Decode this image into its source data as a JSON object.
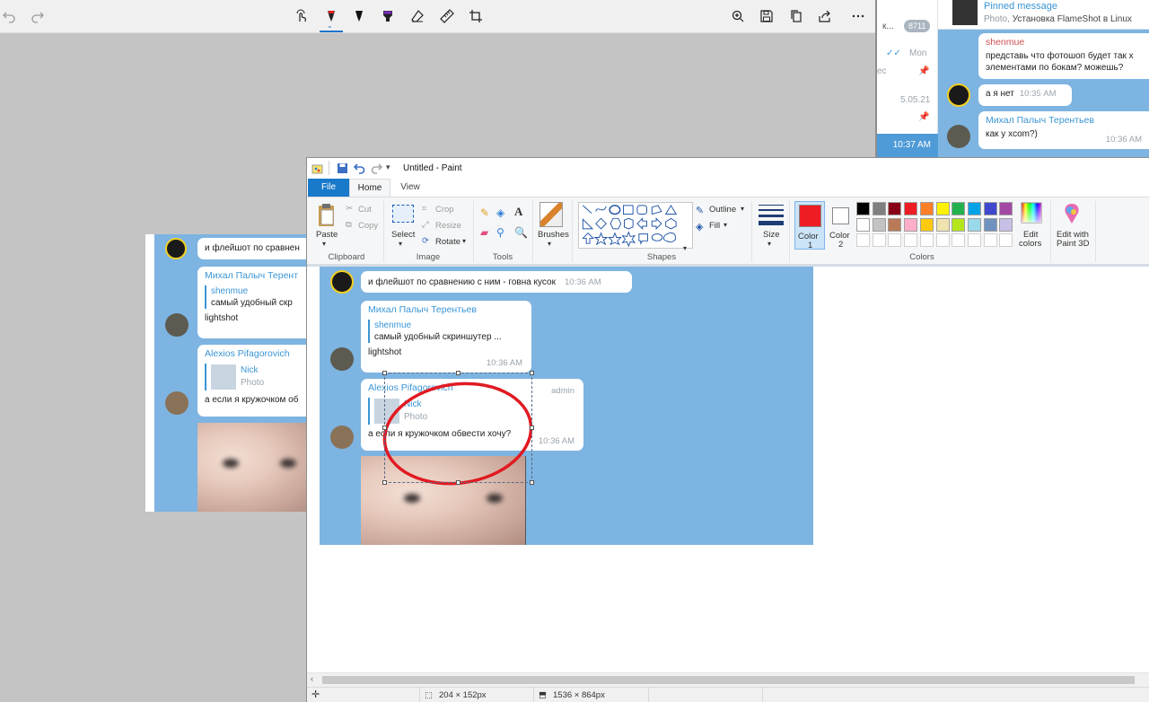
{
  "sketch": {
    "icons": [
      "undo-icon",
      "redo-icon",
      "touch-writing-icon",
      "ballpoint-pen-icon",
      "pencil-icon",
      "highlighter-icon",
      "eraser-icon",
      "ruler-icon",
      "crop-icon",
      "zoom-icon",
      "save-icon",
      "copy-icon",
      "share-icon",
      "more-icon"
    ],
    "colors": {
      "pen_red": "#e02020",
      "pencil_black": "#111111",
      "highlighter_purple": "#7b2fbe",
      "active": "#1e74c9"
    }
  },
  "telegram": {
    "chatlist": {
      "row1_text": "к...",
      "unread": "8711",
      "row2_time": "Mon",
      "row3_text": "ес",
      "row4_time": "5.05.21",
      "selected_time": "10:37 AM"
    },
    "pinned": {
      "title": "Pinned message",
      "prefix": "Photo,",
      "text": "Установка FlameShot в Linux"
    },
    "messages": [
      {
        "sender": "shenmue",
        "line1": "представь что  фотошоп будет так х",
        "line2": "элементами по бокам? можешь?"
      },
      {
        "text": "а я нет",
        "time": "10:35 AM"
      },
      {
        "sender": "Михал Палыч Терентьев",
        "text": "как у xcom?)",
        "time": "10:36 AM"
      }
    ]
  },
  "leftcopy": {
    "msg1": "и флейшот по сравнен",
    "sender1": "Михал Палыч Терент",
    "reply_name": "shenmue",
    "reply_text": "самый удобный скр",
    "msg2": "lightshot",
    "sender2": "Alexios Pifagorovich",
    "photo_name": "Nick",
    "photo_label": "Photo",
    "msg3": "а если я кружочком об"
  },
  "paint": {
    "title": "Untitled - Paint",
    "tabs": {
      "file": "File",
      "home": "Home",
      "view": "View"
    },
    "clipboard": {
      "paste": "Paste",
      "cut": "Cut",
      "copy": "Copy",
      "label": "Clipboard"
    },
    "image": {
      "select": "Select",
      "crop": "Crop",
      "resize": "Resize",
      "rotate": "Rotate",
      "label": "Image"
    },
    "tools": {
      "label": "Tools"
    },
    "brushes": "Brushes",
    "shapes": {
      "outline": "Outline",
      "fill": "Fill",
      "label": "Shapes"
    },
    "size": "Size",
    "color1": {
      "name": "Color",
      "num": "1",
      "value": "#ee1c24"
    },
    "color2": {
      "name": "Color",
      "num": "2",
      "value": "#ffffff"
    },
    "colors_label": "Colors",
    "edit_colors": {
      "line1": "Edit",
      "line2": "colors"
    },
    "paint3d": {
      "line1": "Edit with",
      "line2": "Paint 3D"
    },
    "palette": [
      "#000000",
      "#7f7f7f",
      "#880015",
      "#ed1c24",
      "#ff7f27",
      "#fff200",
      "#22b14c",
      "#00a2e8",
      "#3f48cc",
      "#a349a4",
      "#ffffff",
      "#c3c3c3",
      "#b97a57",
      "#ffaec9",
      "#ffc90e",
      "#efe4b0",
      "#b5e61d",
      "#99d9ea",
      "#7092be",
      "#c8bfe7",
      "#ffffff",
      "#ffffff",
      "#ffffff",
      "#ffffff",
      "#ffffff",
      "#ffffff",
      "#ffffff",
      "#ffffff",
      "#ffffff",
      "#ffffff"
    ],
    "status": {
      "selection": "204 × 152px",
      "canvas": "1536 × 864px"
    }
  },
  "canvas_chat": {
    "msg1": "и флейшот по сравнению с ним - говна кусок",
    "msg1_time": "10:36 AM",
    "sender1": "Михал Палыч Терентьев",
    "reply_name": "shenmue",
    "reply_text": "самый удобный скриншутер ...",
    "msg2": "lightshot",
    "msg2_time": "10:36 AM",
    "sender2": "Alexios Pifagorovich",
    "admin": "admin",
    "photo_name": "Nick",
    "photo_label": "Photo",
    "msg3": "а если я кружочком обвести хочу?",
    "msg3_time": "10:36 AM"
  }
}
